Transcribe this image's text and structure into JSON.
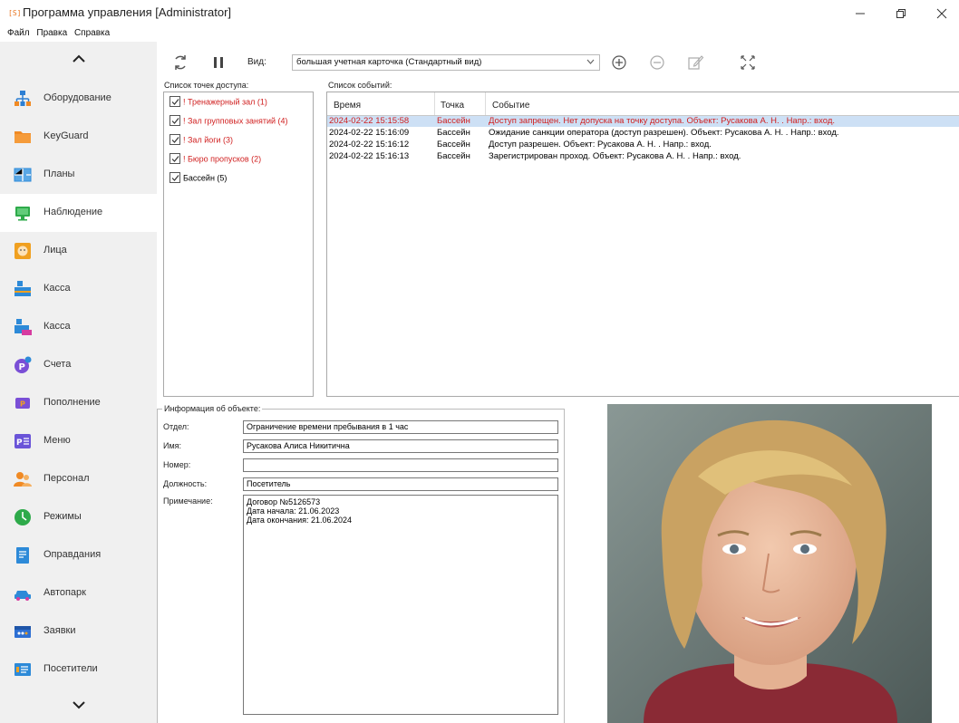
{
  "window": {
    "app_icon_text": "[S]",
    "title": "Программа управления [Administrator]",
    "menu": [
      "Файл",
      "Правка",
      "Справка"
    ]
  },
  "sidebar": {
    "items": [
      {
        "label": "Оборудование",
        "icon": "hierarchy-icon",
        "color": "#2d7fd3"
      },
      {
        "label": "KeyGuard",
        "icon": "folder-icon",
        "color": "#f08a24"
      },
      {
        "label": "Планы",
        "icon": "floorplan-icon",
        "color": "#2d8ad8"
      },
      {
        "label": "Наблюдение",
        "icon": "monitor-icon",
        "color": "#2eaa4a",
        "active": true
      },
      {
        "label": "Лица",
        "icon": "face-icon",
        "color": "#f0a020"
      },
      {
        "label": "Касса",
        "icon": "cashbox-icon",
        "color": "#2d8ad8"
      },
      {
        "label": "Касса",
        "icon": "cashbox-auto-icon",
        "color": "#7a4fd6"
      },
      {
        "label": "Счета",
        "icon": "accounts-icon",
        "color": "#7a4fd6"
      },
      {
        "label": "Пополнение",
        "icon": "topup-icon",
        "color": "#7a4fd6"
      },
      {
        "label": "Меню",
        "icon": "menu-icon",
        "color": "#6a54d8"
      },
      {
        "label": "Персонал",
        "icon": "staff-icon",
        "color": "#f08a24"
      },
      {
        "label": "Режимы",
        "icon": "modes-icon",
        "color": "#2eaa4a"
      },
      {
        "label": "Оправдания",
        "icon": "excuse-icon",
        "color": "#2d8ad8"
      },
      {
        "label": "Автопарк",
        "icon": "car-icon",
        "color": "#2d8ad8"
      },
      {
        "label": "Заявки",
        "icon": "requests-icon",
        "color": "#2d6fd3"
      },
      {
        "label": "Посетители",
        "icon": "visitors-icon",
        "color": "#2d8ad8"
      }
    ]
  },
  "toolbar": {
    "view_label": "Вид:",
    "view_value": "большая учетная карточка (Стандартный вид)"
  },
  "access_points": {
    "title": "Список точек доступа:",
    "items": [
      {
        "label": "! Тренажерный зал (1)",
        "checked": true,
        "alert": true
      },
      {
        "label": "! Зал групповых занятий (4)",
        "checked": true,
        "alert": true
      },
      {
        "label": "! Зал йоги (3)",
        "checked": true,
        "alert": true
      },
      {
        "label": "! Бюро пропусков (2)",
        "checked": true,
        "alert": true
      },
      {
        "label": "Бассейн (5)",
        "checked": true,
        "alert": false
      }
    ]
  },
  "events": {
    "title": "Список событий:",
    "columns": [
      "Время",
      "Точка",
      "Событие"
    ],
    "rows": [
      {
        "time": "2024-02-22 15:15:58",
        "point": "Бассейн",
        "event": "Доступ запрещен. Нет допуска на точку доступа. Объект: Русакова А. Н. . Напр.: вход.",
        "selected": true
      },
      {
        "time": "2024-02-22 15:16:09",
        "point": "Бассейн",
        "event": "Ожидание санкции оператора (доступ разрешен). Объект: Русакова А. Н. . Напр.: вход.",
        "selected": false
      },
      {
        "time": "2024-02-22 15:16:12",
        "point": "Бассейн",
        "event": "Доступ разрешен. Объект: Русакова А. Н. . Напр.: вход.",
        "selected": false
      },
      {
        "time": "2024-02-22 15:16:13",
        "point": "Бассейн",
        "event": "Зарегистрирован проход. Объект: Русакова А. Н. . Напр.: вход.",
        "selected": false
      }
    ]
  },
  "object_info": {
    "title": "Информация об объекте:",
    "department_label": "Отдел:",
    "department": "Ограничение времени пребывания в 1 час",
    "name_label": "Имя:",
    "name": "Русакова Алиса Никитична",
    "number_label": "Номер:",
    "number": "",
    "position_label": "Должность:",
    "position": "Посетитель",
    "note_label": "Примечание:",
    "note_lines": [
      "Договор №5126573",
      "Дата начала: 21.06.2023",
      "Дата окончания: 21.06.2024"
    ]
  }
}
